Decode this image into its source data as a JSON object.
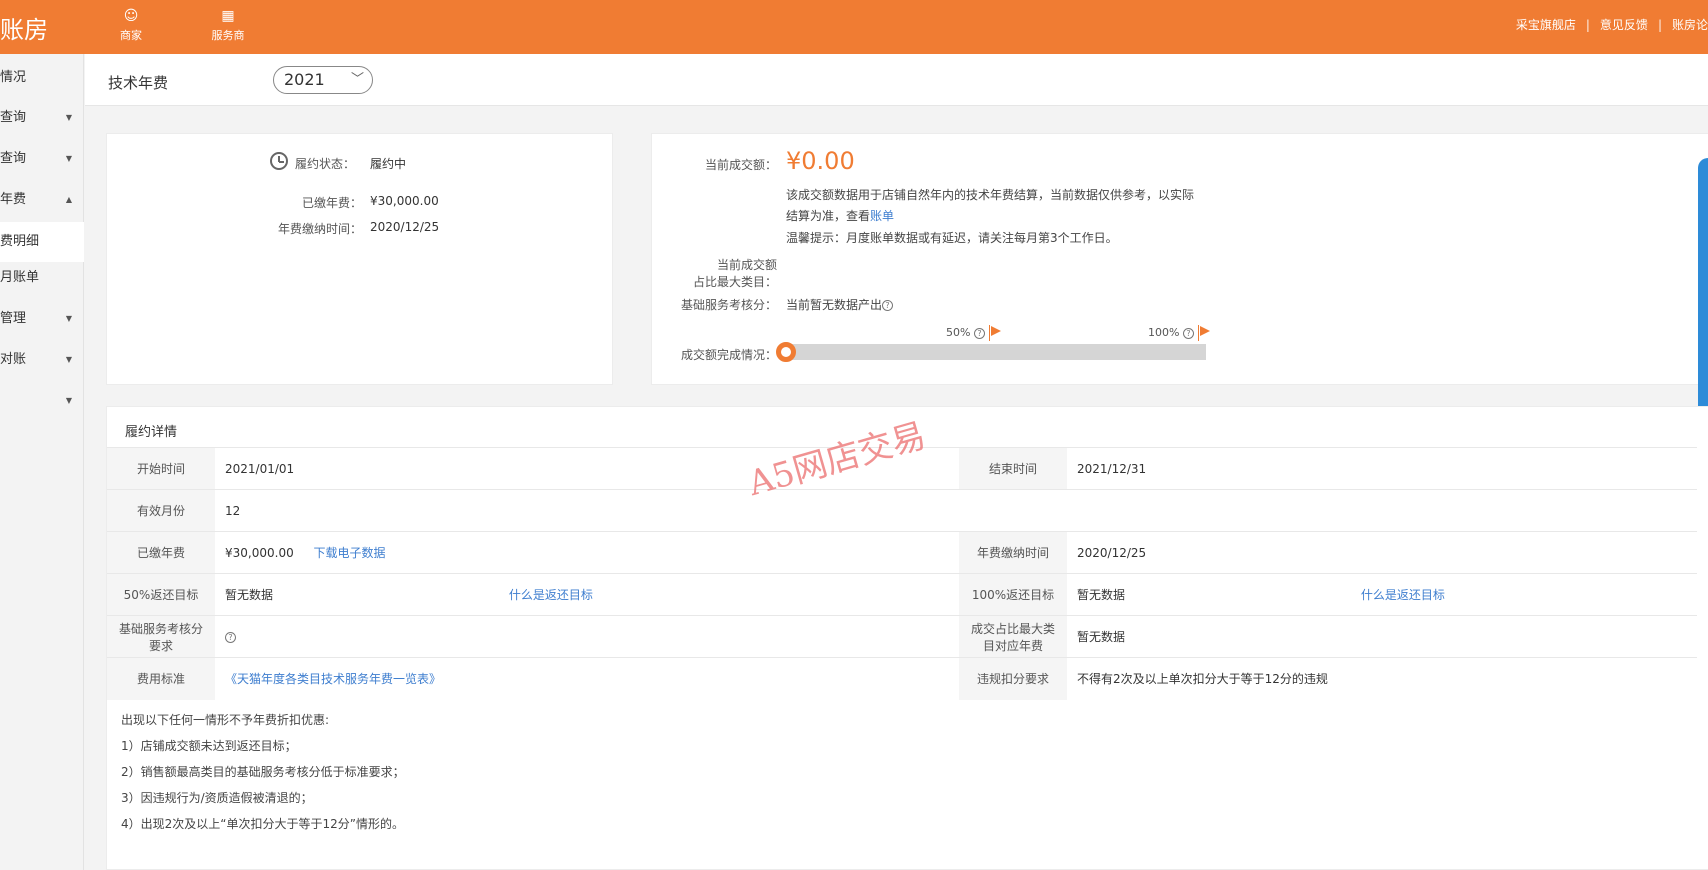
{
  "header": {
    "brand": "账房",
    "nav": [
      {
        "label": "商家",
        "icon": "user-icon"
      },
      {
        "label": "服务商",
        "icon": "grid-icon"
      }
    ],
    "links": [
      "采宝旗舰店",
      "意见反馈",
      "账房论"
    ]
  },
  "sidebar": {
    "items": [
      {
        "label": "情况",
        "arrow": ""
      },
      {
        "label": "查询",
        "arrow": "▼"
      },
      {
        "label": "查询",
        "arrow": "▼"
      },
      {
        "label": "年费",
        "arrow": "▲"
      },
      {
        "label": "费明细",
        "arrow": ""
      },
      {
        "label": "月账单",
        "arrow": ""
      },
      {
        "label": "管理",
        "arrow": "▼"
      },
      {
        "label": "对账",
        "arrow": "▼"
      },
      {
        "label": "",
        "arrow": "▼"
      }
    ]
  },
  "filter": {
    "label": "技术年费",
    "year": "2021"
  },
  "contract_card": {
    "status_label": "履约状态：",
    "status_value": "履约中",
    "paid_label": "已缴年费：",
    "paid_value": "¥30,000.00",
    "paid_time_label": "年费缴纳时间：",
    "paid_time_value": "2020/12/25"
  },
  "sales_card": {
    "current_label": "当前成交额：",
    "current_value": "¥0.00",
    "note_line1": "该成交额数据用于店铺自然年内的技术年费结算，当前数据仅供参考，以实际",
    "note_line2": "结算为准，查看",
    "note_link": "账单",
    "note_line3": "温馨提示：月度账单数据或有延迟，请关注每月第3个工作日。",
    "top_category_label_1": "当前成交额",
    "top_category_label_2": "占比最大类目：",
    "score_label": "基础服务考核分：",
    "score_value": "当前暂无数据产出",
    "completion_label": "成交额完成情况：",
    "milestone_50": "50%",
    "milestone_100": "100%",
    "progress_fraction": 0
  },
  "details": {
    "title": "履约详情",
    "start_label": "开始时间",
    "start_value": "2021/01/01",
    "end_label": "结束时间",
    "end_value": "2021/12/31",
    "months_label": "有效月份",
    "months_value": "12",
    "paid_label": "已缴年费",
    "paid_value": "¥30,000.00",
    "download_link": "下载电子数据",
    "paid_time_label": "年费缴纳时间",
    "paid_time_value": "2020/12/25",
    "target50_label": "50%返还目标",
    "target50_value": "暂无数据",
    "target50_link": "什么是返还目标",
    "target100_label": "100%返还目标",
    "target100_value": "暂无数据",
    "target100_link": "什么是返还目标",
    "score_req_label": "基础服务考核分要求",
    "topcat_fee_label": "成交占比最大类目对应年费",
    "topcat_fee_value": "暂无数据",
    "fee_std_label": "费用标准",
    "fee_std_link": "《天猫年度各类目技术服务年费一览表》",
    "violation_label": "违规扣分要求",
    "violation_value": "不得有2次及以上单次扣分大于等于12分的违规"
  },
  "rules": {
    "intro": "出现以下任何一情形不予年费折扣优惠:",
    "items": [
      "1）店铺成交额未达到返还目标；",
      "2）销售额最高类目的基础服务考核分低于标准要求；",
      "3）因违规行为/资质造假被清退的；",
      "4）出现2次及以上“单次扣分大于等于12分”情形的。"
    ]
  },
  "watermark": "A5网店交易"
}
